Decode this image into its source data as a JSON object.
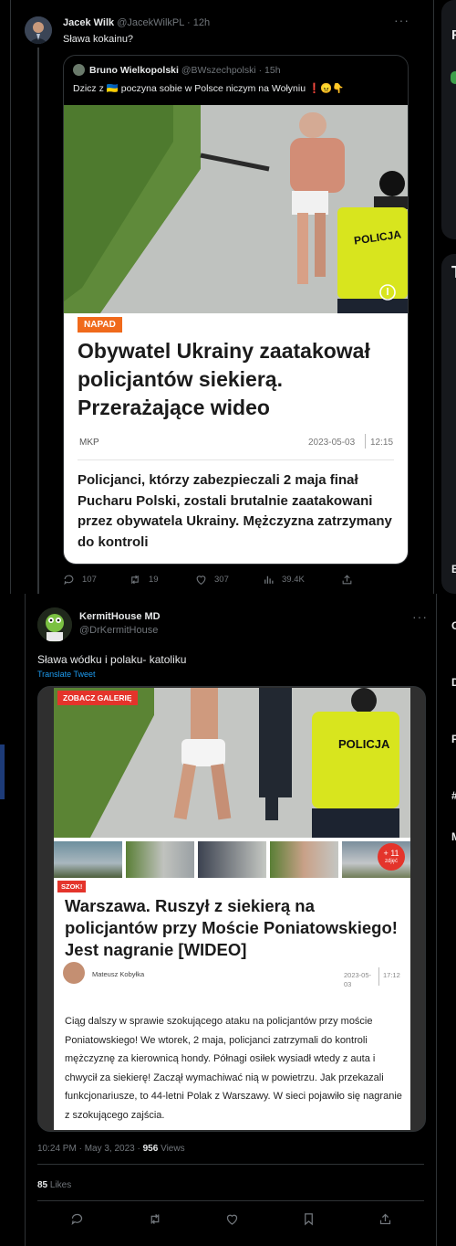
{
  "tweet1": {
    "name": "Jacek Wilk",
    "handle": "@JacekWilkPL",
    "time": "· 12h",
    "text": "Sława kokainu?",
    "quote": {
      "name": "Bruno Wielkopolski",
      "handle": "@BWszechpolski",
      "time": "· 15h",
      "text": "Dzicz z 🇺🇦 poczyna sobie w Polsce niczym na Wołyniu ❗😠👇",
      "article": {
        "badge": "NAPAD",
        "vest_text": "POLICJA",
        "headline": "Obywatel Ukrainy zaatakował policjantów siekierą. Przerażające wideo",
        "author": "MKP",
        "date": "2023-05-03",
        "time": "12:15",
        "lead": "Policjanci, którzy zabezpieczali 2 maja finał Pucharu Polski, zostali brutalnie zaatakowani przez obywatela Ukrainy. Mężczyzna zatrzymany do kontroli"
      }
    },
    "stats": {
      "replies": "107",
      "retweets": "19",
      "likes": "307",
      "views": "39.4K"
    }
  },
  "tweet2": {
    "name": "KermitHouse MD",
    "handle": "@DrKermitHouse",
    "text": "Sława wódku i polaku- katoliku",
    "translate": "Translate Tweet",
    "article": {
      "gallery_label": "ZOBACZ GALERIĘ",
      "vest_text": "POLICJA",
      "more_photos": "+ 11",
      "more_photos_sub": "zdjęć",
      "badge": "SZOK!",
      "headline": "Warszawa. Ruszył z siekierą na policjantów przy Moście Poniatowskiego! Jest nagranie [WIDEO]",
      "author": "Mateusz Kobyłka",
      "date_line1": "2023-05-",
      "date_line2": "03",
      "time": "17:12",
      "body": "Ciąg dalszy w sprawie szokującego ataku na policjantów przy moście Poniatowskiego! We wtorek, 2 maja, policjanci zatrzymali do kontroli mężczyznę za kierownicą hondy. Półnagi osiłek wysiadł wtedy z auta i chwycił za siekierę! Zaczął wymachiwać nią w powietrzu. Jak przekazali funkcjonariusze, to 44-letni Polak z Warszawy. W sieci pojawiło się nagranie z szokującego zajścia."
    },
    "timestamp": "10:24 PM · May 3, 2023 · ",
    "views_count": "956",
    "views_label": " Views",
    "likes_count": "85",
    "likes_label": " Likes"
  },
  "sidebar": {
    "letters": [
      "T",
      "B",
      "G",
      "D",
      "F",
      "#",
      "M"
    ],
    "top_letter": "F"
  },
  "colors": {
    "accent": "#1d9bf0",
    "badge_red": "#e4342b",
    "vest": "#d8e51e"
  }
}
